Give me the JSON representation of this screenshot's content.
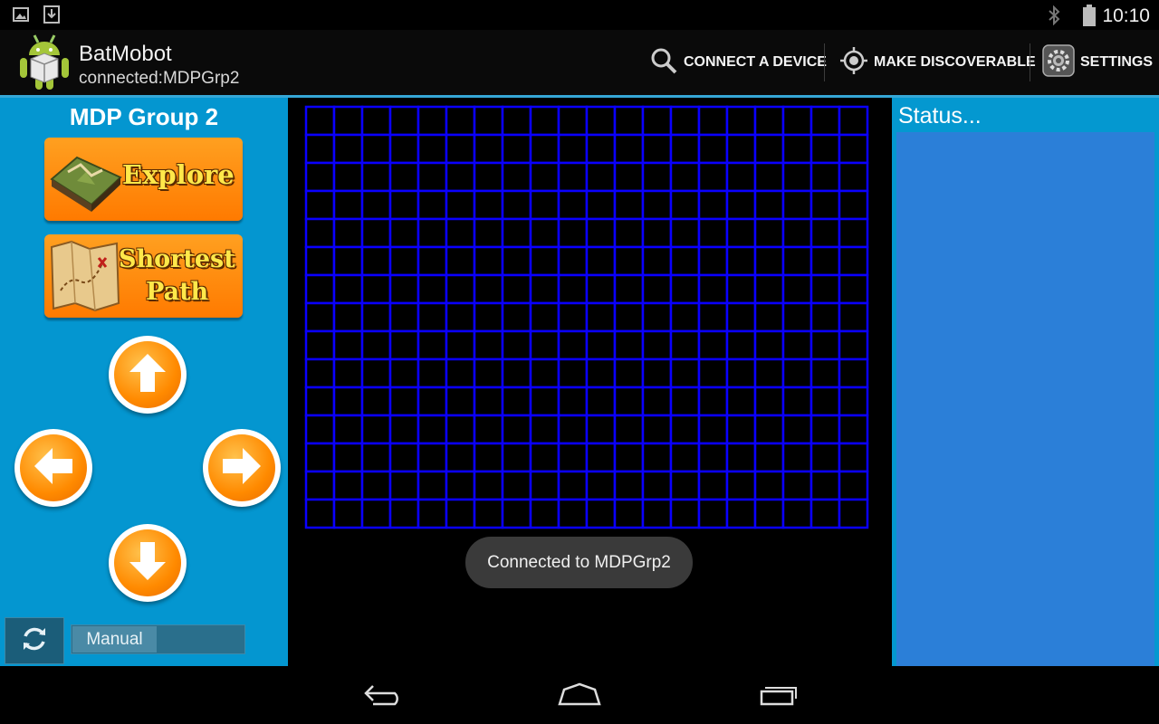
{
  "status_bar": {
    "time": "10:10",
    "icons": [
      "image-icon",
      "download-icon",
      "bluetooth-icon",
      "battery-icon"
    ]
  },
  "action_bar": {
    "app_name": "BatMobot",
    "subtitle": "connected:MDPGrp2",
    "actions": [
      {
        "label": "CONNECT A DEVICE",
        "icon": "search-icon"
      },
      {
        "label": "MAKE DISCOVERABLE",
        "icon": "target-icon"
      },
      {
        "label": "SETTINGS",
        "icon": "gear-icon"
      }
    ]
  },
  "left_panel": {
    "title": "MDP Group 2",
    "explore_label": "Explore",
    "shortest_path_line1": "Shortest",
    "shortest_path_line2": "Path",
    "mode_label": "Manual"
  },
  "arena": {
    "columns": 20,
    "rows": 15,
    "line_color": "#0a00ff",
    "background": "#000000"
  },
  "toast": "Connected to MDPGrp2",
  "right_panel": {
    "title": "Status..."
  },
  "colors": {
    "panel": "#0496d0",
    "status_area": "#2b7fd8",
    "action_bar_accent": "#35a7d6",
    "button_orange": "#ff8a00"
  },
  "nav_bar": {
    "icons": [
      "back-icon",
      "home-icon",
      "recents-icon"
    ]
  }
}
